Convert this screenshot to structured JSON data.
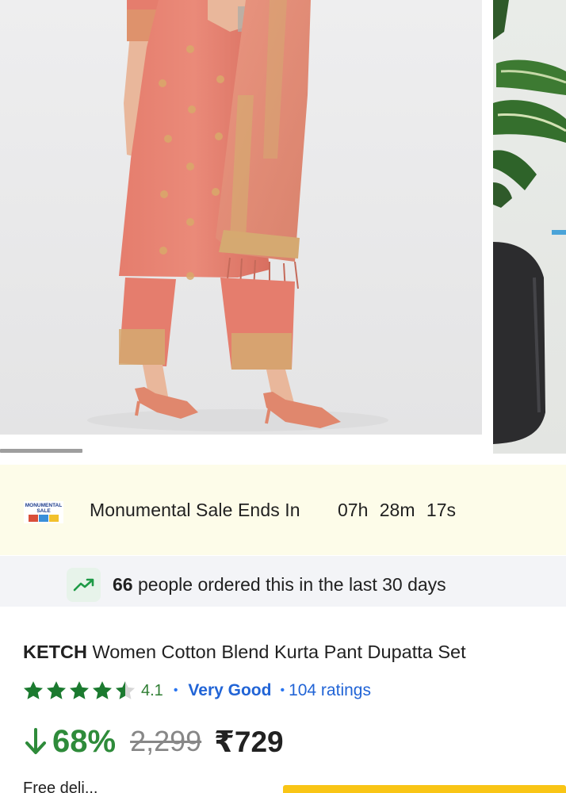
{
  "product": {
    "images": [
      "product-photo-kurta-set",
      "product-photo-next"
    ],
    "brand": "KETCH",
    "title": "Women Cotton Blend Kurta Pant Dupatta Set",
    "rating": "4.1",
    "rating_stars": 4.1,
    "rating_label": "Very Good",
    "rating_count": "104 ratings",
    "discount": "68%",
    "mrp": "2,299",
    "price": "₹729",
    "free_delivery_partial": "Free deli..."
  },
  "sale_banner": {
    "logo_text_line1": "MONUMENTAL",
    "logo_text_line2": "SALE",
    "text": "Monumental Sale Ends In",
    "countdown": "07h 28m  17s"
  },
  "orders": {
    "count": "66",
    "text": " people ordered this in the last 30 days",
    "icon": "trending-up-icon"
  },
  "colors": {
    "star_green": "#1b7a2f",
    "discount_green": "#2e8b3a",
    "link_blue": "#2164d6",
    "banner_bg": "#fdfce9",
    "cta_yellow": "#f9c515"
  }
}
